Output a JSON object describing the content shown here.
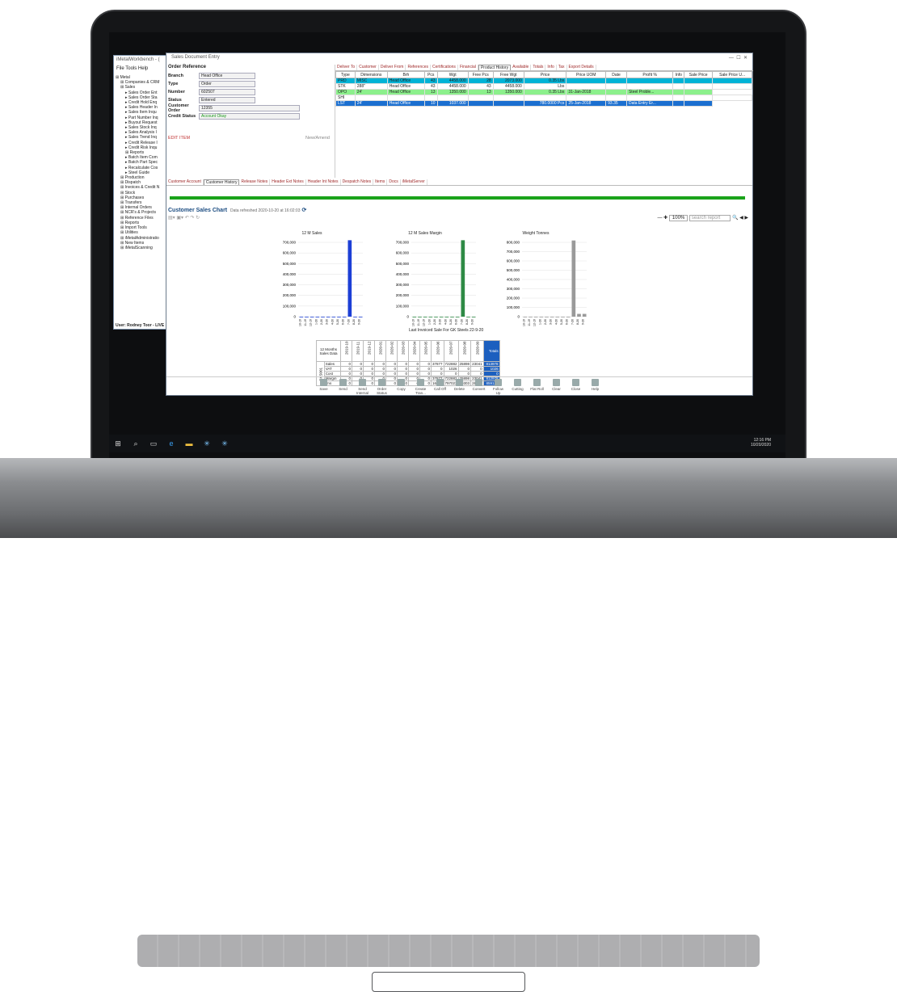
{
  "workbench": {
    "title": "iMetalWorkbench - (",
    "menu": [
      "File",
      "Tools",
      "Help"
    ],
    "status": "User: Rodney Toor - LIVE s",
    "tree": [
      "Metal",
      "Companies & CRM",
      "Sales",
      "Sales Order Ent",
      "Sales Order Sta",
      "Credit Hold Enq",
      "Sales Header In",
      "Sales Item Inqu",
      "Part Number Inq",
      "Buyout Request",
      "Sales Stock Inq",
      "Sales Analysis I",
      "Sales Trend Inq",
      "Credit Release I",
      "Credit Risk Inqu",
      "Reports",
      "Batch Item Com",
      "Batch Part Spec",
      "Recalculate Cos",
      "Steel Guide",
      "Production",
      "Dispatch",
      "Invoices & Credit N",
      "Stock",
      "Purchases",
      "Transfers",
      "Internal Orders",
      "NCR's & Projects",
      "Reference Files",
      "Reports",
      "Import Tools",
      "Utilities",
      "iMetalAdministratio",
      "New Items",
      "iMetalScanning"
    ]
  },
  "doc": {
    "title": "Sales Document Entry",
    "section": "Order Reference",
    "fields": [
      {
        "label": "Branch",
        "value": "Head Office"
      },
      {
        "label": "Type",
        "value": "Order"
      },
      {
        "label": "Number",
        "value": "602507"
      },
      {
        "label": "Status",
        "value": "Entered"
      },
      {
        "label": "Customer Order",
        "value": "12355"
      },
      {
        "label": "Credit Status",
        "value": "Account Okay"
      }
    ],
    "edit": "EDIT ITEM",
    "newamend": "New/Amend"
  },
  "toptabs": [
    "Deliver To",
    "Customer",
    "Deliver From",
    "References",
    "Certifications",
    "Financial",
    "Product History",
    "Available",
    "Totals",
    "Info",
    "Tax",
    "Export Details"
  ],
  "ptable": {
    "headers": [
      "Type",
      "Dimensions",
      "Brh",
      "Pcs",
      "Wgt",
      "Free Pcs",
      "Free Wgt",
      "Price",
      "Price UOM",
      "Date",
      "Profit %",
      "Info",
      "Sale Price",
      "Sale Price U..."
    ],
    "rows": [
      [
        "PRD",
        "MISC",
        "Head Office",
        "43",
        "4458.000",
        "28",
        "2073.000",
        "0.35 Lbs",
        "",
        "",
        "",
        "",
        "",
        ""
      ],
      [
        "STK",
        "288\"",
        "Head Office",
        "43",
        "4458.000",
        "43",
        "4458.000",
        "Lbs",
        "",
        "",
        "",
        "",
        "",
        ""
      ],
      [
        "OPO",
        "24'",
        "Head Office",
        "13",
        "1350.000",
        "13",
        "1350.000",
        "0.35 Lbs",
        "31-Jan-2018",
        "",
        "Steel Proble...",
        "",
        ""
      ],
      [
        "SHI",
        "",
        "",
        "",
        "",
        "",
        "",
        "",
        "",
        "",
        "",
        "",
        "",
        ""
      ],
      [
        "LST",
        "24'",
        "Head Office",
        "10",
        "1037.000",
        "",
        "",
        "780.0000 Pcs",
        "25-Jan-2018",
        "93.35",
        "Data Entry Er...",
        "",
        ""
      ]
    ]
  },
  "lowtabs": [
    "Customer Account",
    "Customer History",
    "Release Notes",
    "Header Ext Notes",
    "Header Int Notes",
    "Despatch Notes",
    "Items",
    "Docs",
    "iMetalServer"
  ],
  "chartsec": {
    "title": "Customer Sales Chart",
    "refreshed": "Data refreshed 2020-10-20 at 16:02:03",
    "zoom": "100%",
    "search": "search report"
  },
  "charts": [
    {
      "title": "12 M Sales",
      "color": "#1c3fd6",
      "ticks": [
        "700,000",
        "600,000",
        "500,000",
        "400,000",
        "300,000",
        "200,000",
        "100,000",
        "0"
      ]
    },
    {
      "title": "12 M Sales Margin",
      "color": "#2e8a45",
      "ticks": [
        "700,000",
        "600,000",
        "500,000",
        "400,000",
        "300,000",
        "200,000",
        "100,000",
        "0"
      ]
    },
    {
      "title": "Weight Tonnes",
      "color": "#9a9a9a",
      "ticks": [
        "800,000",
        "700,000",
        "600,000",
        "500,000",
        "400,000",
        "300,000",
        "200,000",
        "100,000",
        "0"
      ]
    }
  ],
  "chart_data": [
    {
      "type": "bar",
      "title": "12 M Sales",
      "categories": [
        "10-19",
        "11-19",
        "12-19",
        "1-20",
        "2-20",
        "3-20",
        "4-20",
        "5-20",
        "6-20",
        "7-20",
        "8-20",
        "9-20"
      ],
      "values": [
        0,
        0,
        0,
        0,
        0,
        0,
        0,
        0,
        0,
        720000,
        0,
        0
      ],
      "ylim": [
        0,
        700000
      ]
    },
    {
      "type": "bar",
      "title": "12 M Sales Margin",
      "categories": [
        "10-19",
        "11-19",
        "12-19",
        "1-20",
        "2-20",
        "3-20",
        "4-20",
        "5-20",
        "6-20",
        "7-20",
        "8-20",
        "9-20"
      ],
      "values": [
        0,
        0,
        0,
        0,
        0,
        0,
        0,
        0,
        0,
        720000,
        0,
        0
      ],
      "ylim": [
        0,
        700000
      ]
    },
    {
      "type": "bar",
      "title": "Weight Tonnes",
      "categories": [
        "10-19",
        "11-19",
        "12-19",
        "1-20",
        "2-20",
        "3-20",
        "4-20",
        "5-20",
        "6-20",
        "7-20",
        "8-20",
        "9-20"
      ],
      "values": [
        0,
        0,
        0,
        0,
        0,
        0,
        0,
        0,
        0,
        820000,
        30000,
        30000
      ],
      "ylim": [
        0,
        800000
      ]
    }
  ],
  "lastinv": "Last Invoiced Sale For GK Steels 22-9-20",
  "months": [
    "2019-10",
    "2019-11",
    "2019-12",
    "2020-01",
    "2020-02",
    "2020-03",
    "2020-04",
    "2020-05",
    "2020-06",
    "2020-07",
    "2020-08",
    "2020-09",
    "Totals"
  ],
  "brows": [
    [
      "Sales",
      "0",
      "0",
      "0",
      "0",
      "0",
      "0",
      "0",
      "0",
      "37877",
      "722882",
      "25898",
      "23041",
      "813978"
    ],
    [
      "VAT",
      "0",
      "0",
      "0",
      "0",
      "0",
      "0",
      "0",
      "0",
      "0",
      "1026",
      "0",
      "0",
      "1026"
    ],
    [
      "Cost",
      "0",
      "0",
      "0",
      "0",
      "0",
      "0",
      "0",
      "0",
      "0",
      "0",
      "0",
      "0",
      "0"
    ],
    [
      "Margin",
      "0",
      "0",
      "0",
      "0",
      "0",
      "0",
      "0",
      "0",
      "37877",
      "722882",
      "25898",
      "23041",
      "812978"
    ],
    [
      "Tns",
      "0",
      "0",
      "0",
      "0",
      "0",
      "0",
      "0",
      "0",
      "16854",
      "797023",
      "30303",
      "28554",
      "859131"
    ]
  ],
  "bhead": "12 Months Sales Data",
  "bcode": "GKS001",
  "buttons": [
    "Save",
    "Send",
    "Send Internal",
    "Order Status",
    "Copy",
    "Create Tran...",
    "Call Off",
    "Delete",
    "Convert",
    "Follow Up",
    "Cutting",
    "Flat Roll",
    "Clear",
    "Close",
    "Help"
  ],
  "clock": {
    "time": "12:16 PM",
    "date": "10/20/2020"
  }
}
